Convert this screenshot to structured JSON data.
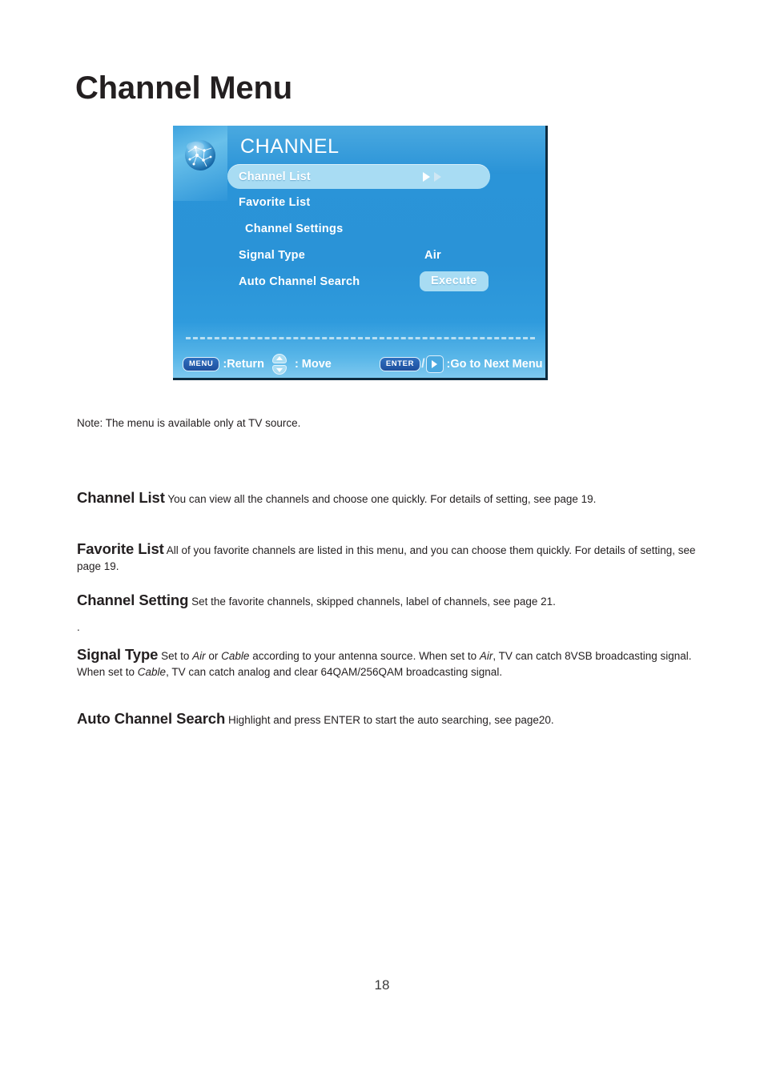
{
  "page": {
    "title": "Channel Menu",
    "number": "18"
  },
  "osd": {
    "icon": "globe-network-icon",
    "title": "CHANNEL",
    "items": [
      {
        "label": "Channel List",
        "value": "",
        "highlighted": true,
        "arrows": true,
        "indent": false
      },
      {
        "label": "Favorite List",
        "value": "",
        "highlighted": false,
        "arrows": false,
        "indent": false
      },
      {
        "label": "Channel Settings",
        "value": "",
        "highlighted": false,
        "arrows": false,
        "indent": true
      },
      {
        "label": "Signal Type",
        "value": "Air",
        "highlighted": false,
        "arrows": false,
        "indent": false
      },
      {
        "label": "Auto Channel Search",
        "value": "Execute",
        "highlighted": false,
        "arrows": false,
        "indent": false
      }
    ],
    "execute_button": "Execute",
    "footer": {
      "menu_key": "MENU",
      "menu_action": ":Return",
      "move_action": ": Move",
      "enter_key": "ENTER",
      "separator": "/",
      "enter_action": ":Go to Next Menu"
    },
    "colors": {
      "panel_blue": "#2a93d7",
      "highlight_blue": "#a8dcf3",
      "key_blue": "#1e4f9e",
      "text_white": "#ffffff"
    }
  },
  "note": "Note: The menu is available only at TV source.",
  "sections": [
    {
      "id": "channel-list",
      "heading": "Channel List",
      "body": " You can view all the channels and choose one quickly. For details of setting, see page 19."
    },
    {
      "id": "favorite-list",
      "heading": "Favorite List",
      "body": " All of you favorite channels are listed in this menu, and you can choose them quickly. For details of setting, see page 19."
    },
    {
      "id": "channel-setting",
      "heading": "Channel Setting",
      "body": " Set the favorite channels, skipped channels, label of channels, see page 21."
    },
    {
      "id": "signal-type",
      "heading": "Signal Type",
      "body_part1": " Set to ",
      "italic1": "Air",
      "body_part2": " or ",
      "italic2": "Cable",
      "body_part3": " according to your antenna source.  When set to ",
      "italic3": "Air",
      "body_part4": ", TV can catch 8VSB broadcasting signal. When set to ",
      "italic4": "Cable",
      "body_part5": ", TV can catch analog and clear 64QAM/256QAM broadcasting signal."
    },
    {
      "id": "auto-channel-search",
      "heading": "Auto Channel Search",
      "body": " Highlight and press ENTER to start the auto searching, see page20."
    }
  ],
  "stray_mark": "."
}
